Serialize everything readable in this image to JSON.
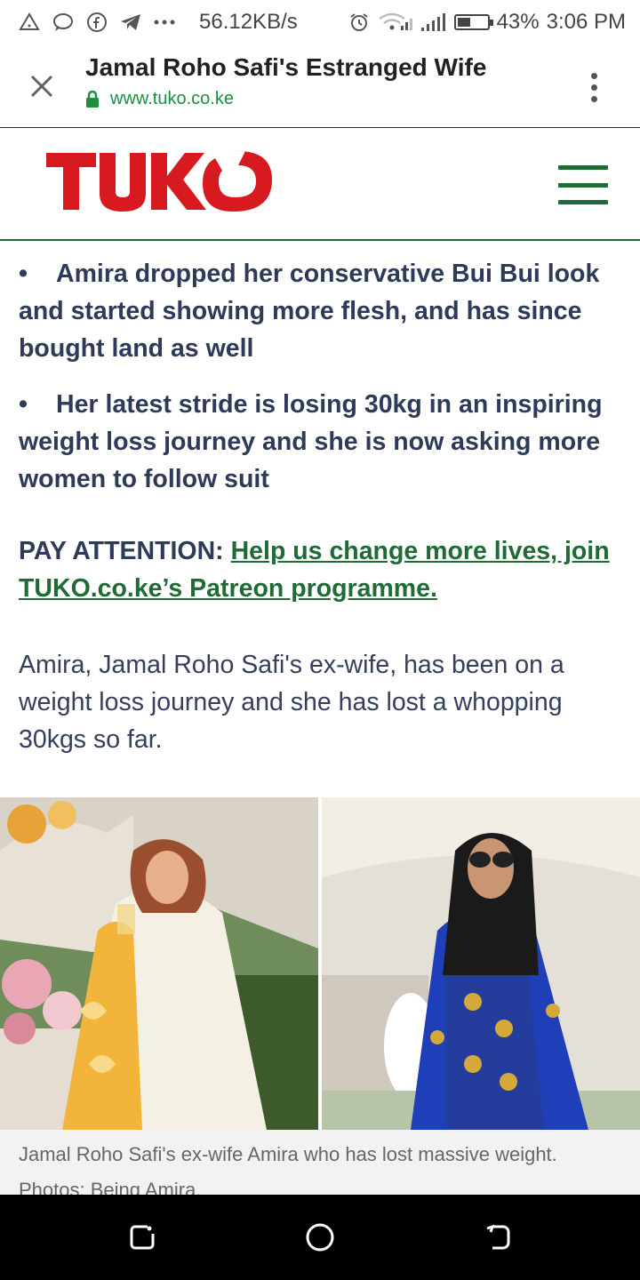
{
  "status_bar": {
    "speed": "56.12KB/s",
    "battery_percent": "43%",
    "battery_level": 0.43,
    "time": "3:06 PM",
    "icons": [
      "alert-icon",
      "chat-icon",
      "facebook-icon",
      "telegram-icon",
      "more-dots-icon",
      "alarm-icon",
      "wifi-icon",
      "signal-icon",
      "signal-icon-2",
      "battery-icon"
    ]
  },
  "tab": {
    "title": "Jamal Roho Safi's Estranged Wife",
    "url": "www.tuko.co.ke"
  },
  "site": {
    "logo_text": "TUKO",
    "brand_red": "#d71920",
    "brand_green": "#1f6b35"
  },
  "article": {
    "bullets": [
      "Amira dropped her conservative Bui Bui look and started showing more flesh, and has since bought land as well",
      "Her latest stride is losing 30kg in an inspiring weight loss journey and she is now asking more women to follow suit"
    ],
    "pay_attention_label": "PAY ATTENTION:",
    "pay_attention_link": "Help us change more lives, join TUKO.co.ke’s Patreon programme.",
    "paragraph": "Amira, Jamal Roho Safi's ex-wife, has been on a weight loss journey and she has lost a whopping 30kgs so far.",
    "caption": "Jamal Roho Safi's ex-wife Amira who has lost massive weight. Photos: Being Amira."
  },
  "nav": {
    "icons": [
      "recent-apps-icon",
      "home-icon",
      "back-icon"
    ]
  }
}
